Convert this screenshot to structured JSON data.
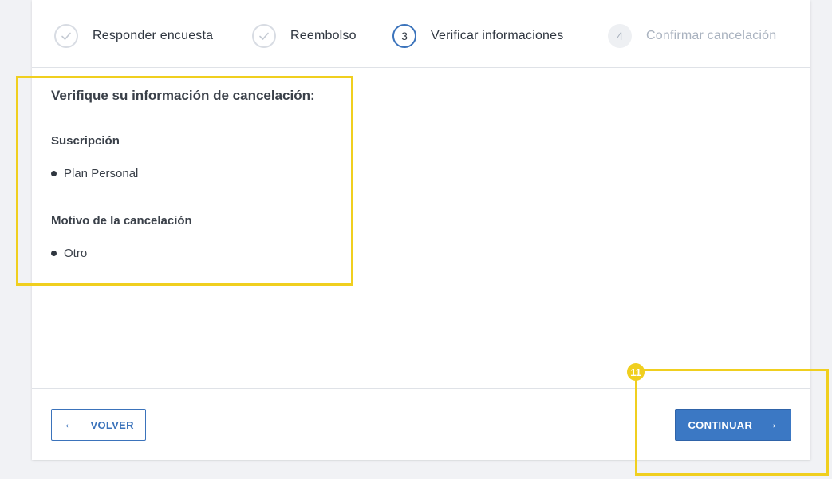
{
  "stepper": {
    "steps": [
      {
        "label": "Responder encuesta",
        "state": "done",
        "number": ""
      },
      {
        "label": "Reembolso",
        "state": "done",
        "number": ""
      },
      {
        "label": "Verificar informaciones",
        "state": "active",
        "number": "3"
      },
      {
        "label": "Confirmar cancelación",
        "state": "pending",
        "number": "4"
      }
    ]
  },
  "content": {
    "title": "Verifique su información de cancelación:",
    "subscription": {
      "heading": "Suscripción",
      "value": "Plan Personal"
    },
    "reason": {
      "heading": "Motivo de la cancelación",
      "value": "Otro"
    }
  },
  "footer": {
    "back_label": "VOLVER",
    "next_label": "CONTINUAR",
    "back_arrow": "←",
    "next_arrow": "→"
  },
  "annotation": {
    "badge_number": "11",
    "highlight_color": "#f0cf1f"
  },
  "colors": {
    "accent": "#3b73bb",
    "primary_button": "#3b78c4",
    "pending_text": "#a9b2bf",
    "background": "#f1f2f5"
  },
  "icons": {
    "step_done": "check-icon",
    "back": "arrow-left-icon",
    "next": "arrow-right-icon"
  }
}
